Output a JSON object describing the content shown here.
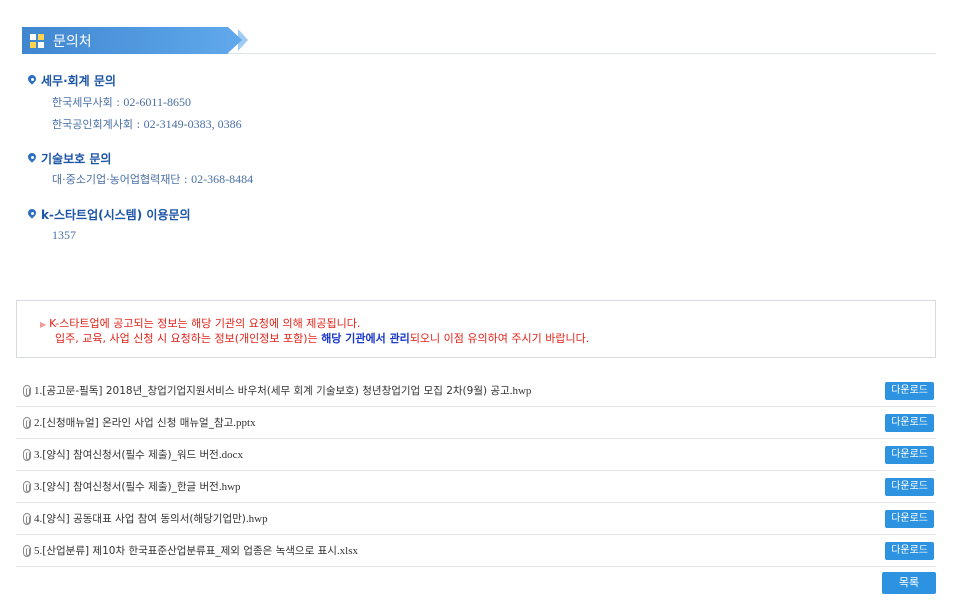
{
  "section": {
    "title": "문의처"
  },
  "contacts": [
    {
      "title": "세무·회계 문의",
      "lines": [
        {
          "org": "한국세무사회 : ",
          "num": "02-6011-8650"
        },
        {
          "org": "한국공인회계사회 : ",
          "num": "02-3149-0383, 0386"
        }
      ]
    },
    {
      "title": "기술보호 문의",
      "lines": [
        {
          "org": "대·중소기업·농어업협력재단 : ",
          "num": "02-368-8484"
        }
      ]
    },
    {
      "title": "k-스타트업(시스템) 이용문의",
      "lines": [
        {
          "org": "",
          "num": "1357"
        }
      ]
    }
  ],
  "notice": {
    "line1": "K-스타트업에 공고되는 정보는 해당 기관의 요청에 의해 제공됩니다.",
    "line2_a": "입주, 교육, 사업 신청 시 요청하는 정보(개인정보 포함)는 ",
    "line2_b": "해당 기관에서 관리",
    "line2_c": "되오니 이점 유의하여 주시기 바랍니다."
  },
  "files": [
    {
      "prefix": "1. ",
      "name": "[공고문-필독] 2018년_창업기업지원서비스 바우처(세무 회계 기술보호) 청년창업기업 모집 2차(9월) 공고",
      "ext": ".hwp",
      "button": "다운로드"
    },
    {
      "prefix": "2. ",
      "name": "[신청매뉴얼] 온라인 사업 신청 매뉴얼_참고",
      "ext": ".pptx",
      "button": "다운로드"
    },
    {
      "prefix": "3. ",
      "name": "[양식] 참여신청서(필수 제출)_워드 버전",
      "ext": ".docx",
      "button": "다운로드"
    },
    {
      "prefix": "3. ",
      "name": "[양식] 참여신청서(필수 제출)_한글 버전",
      "ext": ".hwp",
      "button": "다운로드"
    },
    {
      "prefix": "4. ",
      "name": "[양식] 공동대표 사업 참여 동의서(해당기업만)",
      "ext": ".hwp",
      "button": "다운로드"
    },
    {
      "prefix": "5. ",
      "name": "[산업분류] 제10차 한국표준산업분류표_제외 업종은 녹색으로 표시",
      "ext": ".xlsx",
      "button": "다운로드"
    }
  ],
  "list_button": "목록",
  "colors": {
    "accent": "#2d93e0",
    "notice_red": "#e2231a",
    "notice_blue": "#1a38c9",
    "link_blue": "#1d56a7"
  }
}
